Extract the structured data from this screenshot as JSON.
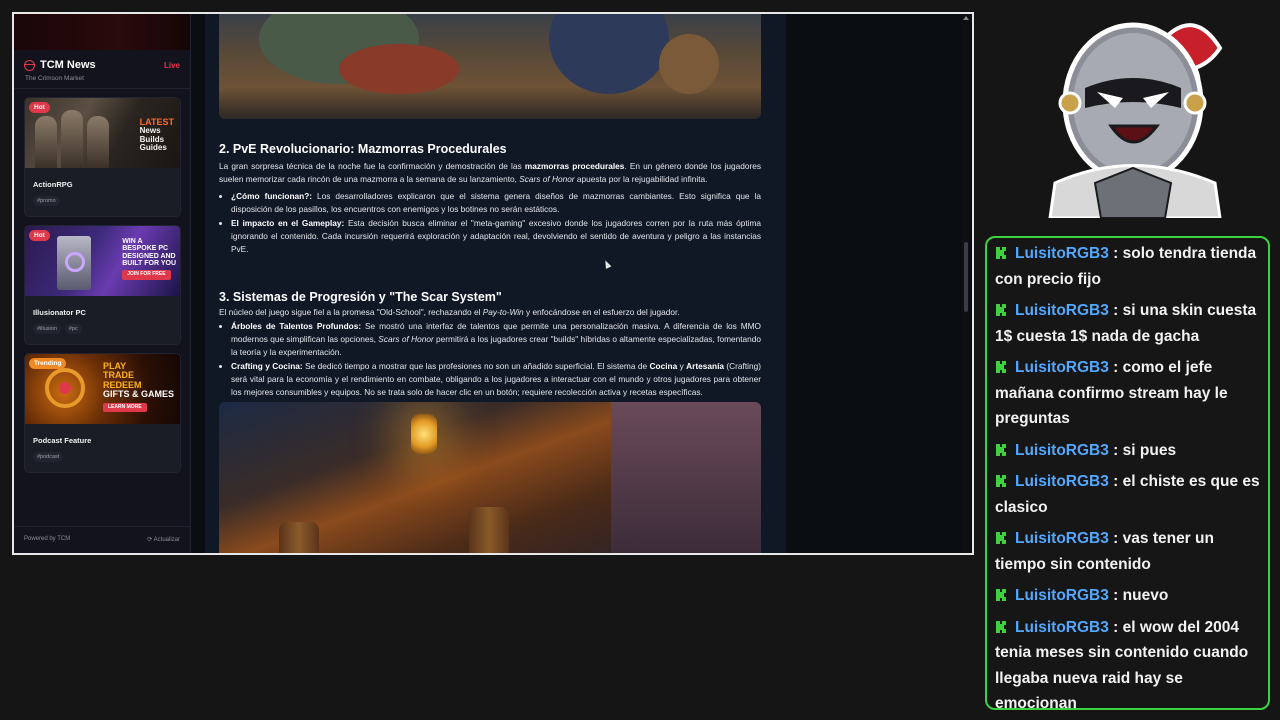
{
  "sidebar": {
    "brand": "TCM News",
    "live": "Live",
    "subtitle": "The Crimson Market",
    "cards": [
      {
        "badge": "Hot",
        "thumb_lines": [
          "LATEST",
          "News",
          "Builds",
          "Guides"
        ],
        "title": "ActionRPG",
        "tags": [
          "#promo"
        ]
      },
      {
        "badge": "Hot",
        "thumb_lines": [
          "WIN A",
          "BESPOKE PC",
          "DESIGNED AND",
          "BUILT FOR YOU"
        ],
        "thumb_button": "JOIN FOR FREE",
        "title": "Illusionator PC",
        "tags": [
          "#illusion",
          "#pc"
        ]
      },
      {
        "badge": "Trending",
        "thumb_lines": [
          "PLAY",
          "TRADE",
          "REDEEM",
          "GIFTS & GAMES"
        ],
        "thumb_button": "LEARN MORE",
        "title": "Podcast Feature",
        "tags": [
          "#podcast"
        ]
      }
    ],
    "footer": {
      "powered": "Powered by TCM",
      "refresh": "Actualizar"
    }
  },
  "article": {
    "s2": {
      "heading": "2. PvE Revolucionario: Mazmorras Procedurales",
      "p1_a": "La gran sorpresa técnica de la noche fue la confirmación y demostración de las ",
      "p1_b": "mazmorras procedurales",
      "p1_c": ". En un género donde los jugadores suelen memorizar cada rincón de una mazmorra a la semana de su lanzamiento, ",
      "p1_d": "Scars of Honor",
      "p1_e": " apuesta por la rejugabilidad infinita.",
      "b1_label": "¿Cómo funcionan?:",
      "b1_text": " Los desarrolladores explicaron que el sistema genera diseños de mazmorras cambiantes. Esto significa que la disposición de los pasillos, los encuentros con enemigos y los botines no serán estáticos.",
      "b2_label": "El impacto en el Gameplay:",
      "b2_text": " Esta decisión busca eliminar el \"meta-gaming\" excesivo donde los jugadores corren por la ruta más óptima ignorando el contenido. Cada incursión requerirá exploración y adaptación real, devolviendo el sentido de aventura y peligro a las instancias PvE."
    },
    "s3": {
      "heading": "3. Sistemas de Progresión y \"The Scar System\"",
      "p1_a": "El núcleo del juego sigue fiel a la promesa \"Old-School\", rechazando el ",
      "p1_b": "Pay-to-Win",
      "p1_c": " y enfocándose en el esfuerzo del jugador.",
      "b1_label": "Árboles de Talentos Profundos:",
      "b1_a": " Se mostró una interfaz de talentos que permite una personalización masiva. A diferencia de los MMO modernos que simplifican las opciones, ",
      "b1_b": "Scars of Honor",
      "b1_c": " permitirá a los jugadores crear \"builds\" híbridas o altamente especializadas, fomentando la teoría y la experimentación.",
      "b2_label": "Crafting y Cocina:",
      "b2_a": " Se dedicó tiempo a mostrar que las profesiones no son un añadido superficial. El sistema de ",
      "b2_b": "Cocina",
      "b2_c": " y ",
      "b2_d": "Artesanía",
      "b2_e": " (Crafting) será vital para la economía y el rendimiento en combate, obligando a los jugadores a interactuar con el mundo y otros jugadores para obtener los mejores consumibles y equipos. No se trata solo de hacer clic en un botón; requiere recolección activa y recetas específicas."
    }
  },
  "chat": {
    "user": "LuisitoRGB3",
    "accent": "#3dd23f",
    "username_color": "#52a8ff",
    "messages": [
      {
        "user": "LuisitoRGB3",
        "text": " : solo tendra tienda con precio fijo"
      },
      {
        "user": "LuisitoRGB3",
        "text": " : si una skin cuesta 1$ cuesta 1$ nada de gacha"
      },
      {
        "user": "LuisitoRGB3",
        "text": " : como el jefe mañana confirmo stream hay le preguntas"
      },
      {
        "user": "LuisitoRGB3",
        "text": " : si pues"
      },
      {
        "user": "LuisitoRGB3",
        "text": " : el chiste es que es clasico"
      },
      {
        "user": "LuisitoRGB3",
        "text": " : vas tener un tiempo sin contenido"
      },
      {
        "user": "LuisitoRGB3",
        "text": " : nuevo"
      },
      {
        "user": "LuisitoRGB3",
        "text": " : el wow del 2004 tenia meses sin contenido cuando llegaba nueva raid hay se emocionan"
      }
    ]
  },
  "colors": {
    "brand_red": "#e0384b",
    "trending_orange": "#f08a24",
    "chat_border": "#3dd23f"
  }
}
